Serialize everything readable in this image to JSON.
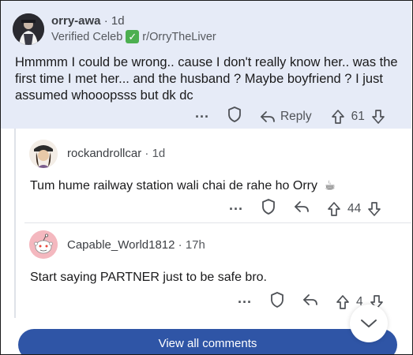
{
  "parent_comment": {
    "username": "orry-awa",
    "time": "1d",
    "flair_text": "Verified Celeb",
    "flair_subreddit": "r/OrryTheLiver",
    "body": "Hmmmm I could be wrong.. cause I don't really know her.. was the first time I met her... and the husband ? Maybe boyfriend ? I just assumed whooopsss but dk dc",
    "reply_label": "Reply",
    "score": "61"
  },
  "replies": [
    {
      "username": "rockandrollcar",
      "time": "1d",
      "body": "Tum hume railway station wali chai de rahe ho Orry",
      "emoji": "☕",
      "score": "44"
    },
    {
      "username": "Capable_World1812",
      "time": "17h",
      "body": "Start saying PARTNER just to be safe bro.",
      "score": "4"
    }
  ],
  "footer": {
    "view_all_label": "View all comments"
  },
  "icons": {
    "more": "more-dots-icon",
    "award": "shield-award-icon",
    "reply": "reply-arrow-icon",
    "upvote": "upvote-arrow-icon",
    "downvote": "downvote-arrow-icon",
    "expand": "chevron-down-icon"
  },
  "colors": {
    "highlight_bg": "#e6ebf7",
    "button_blue": "#2f55a6",
    "flair_check": "#4caf50"
  }
}
